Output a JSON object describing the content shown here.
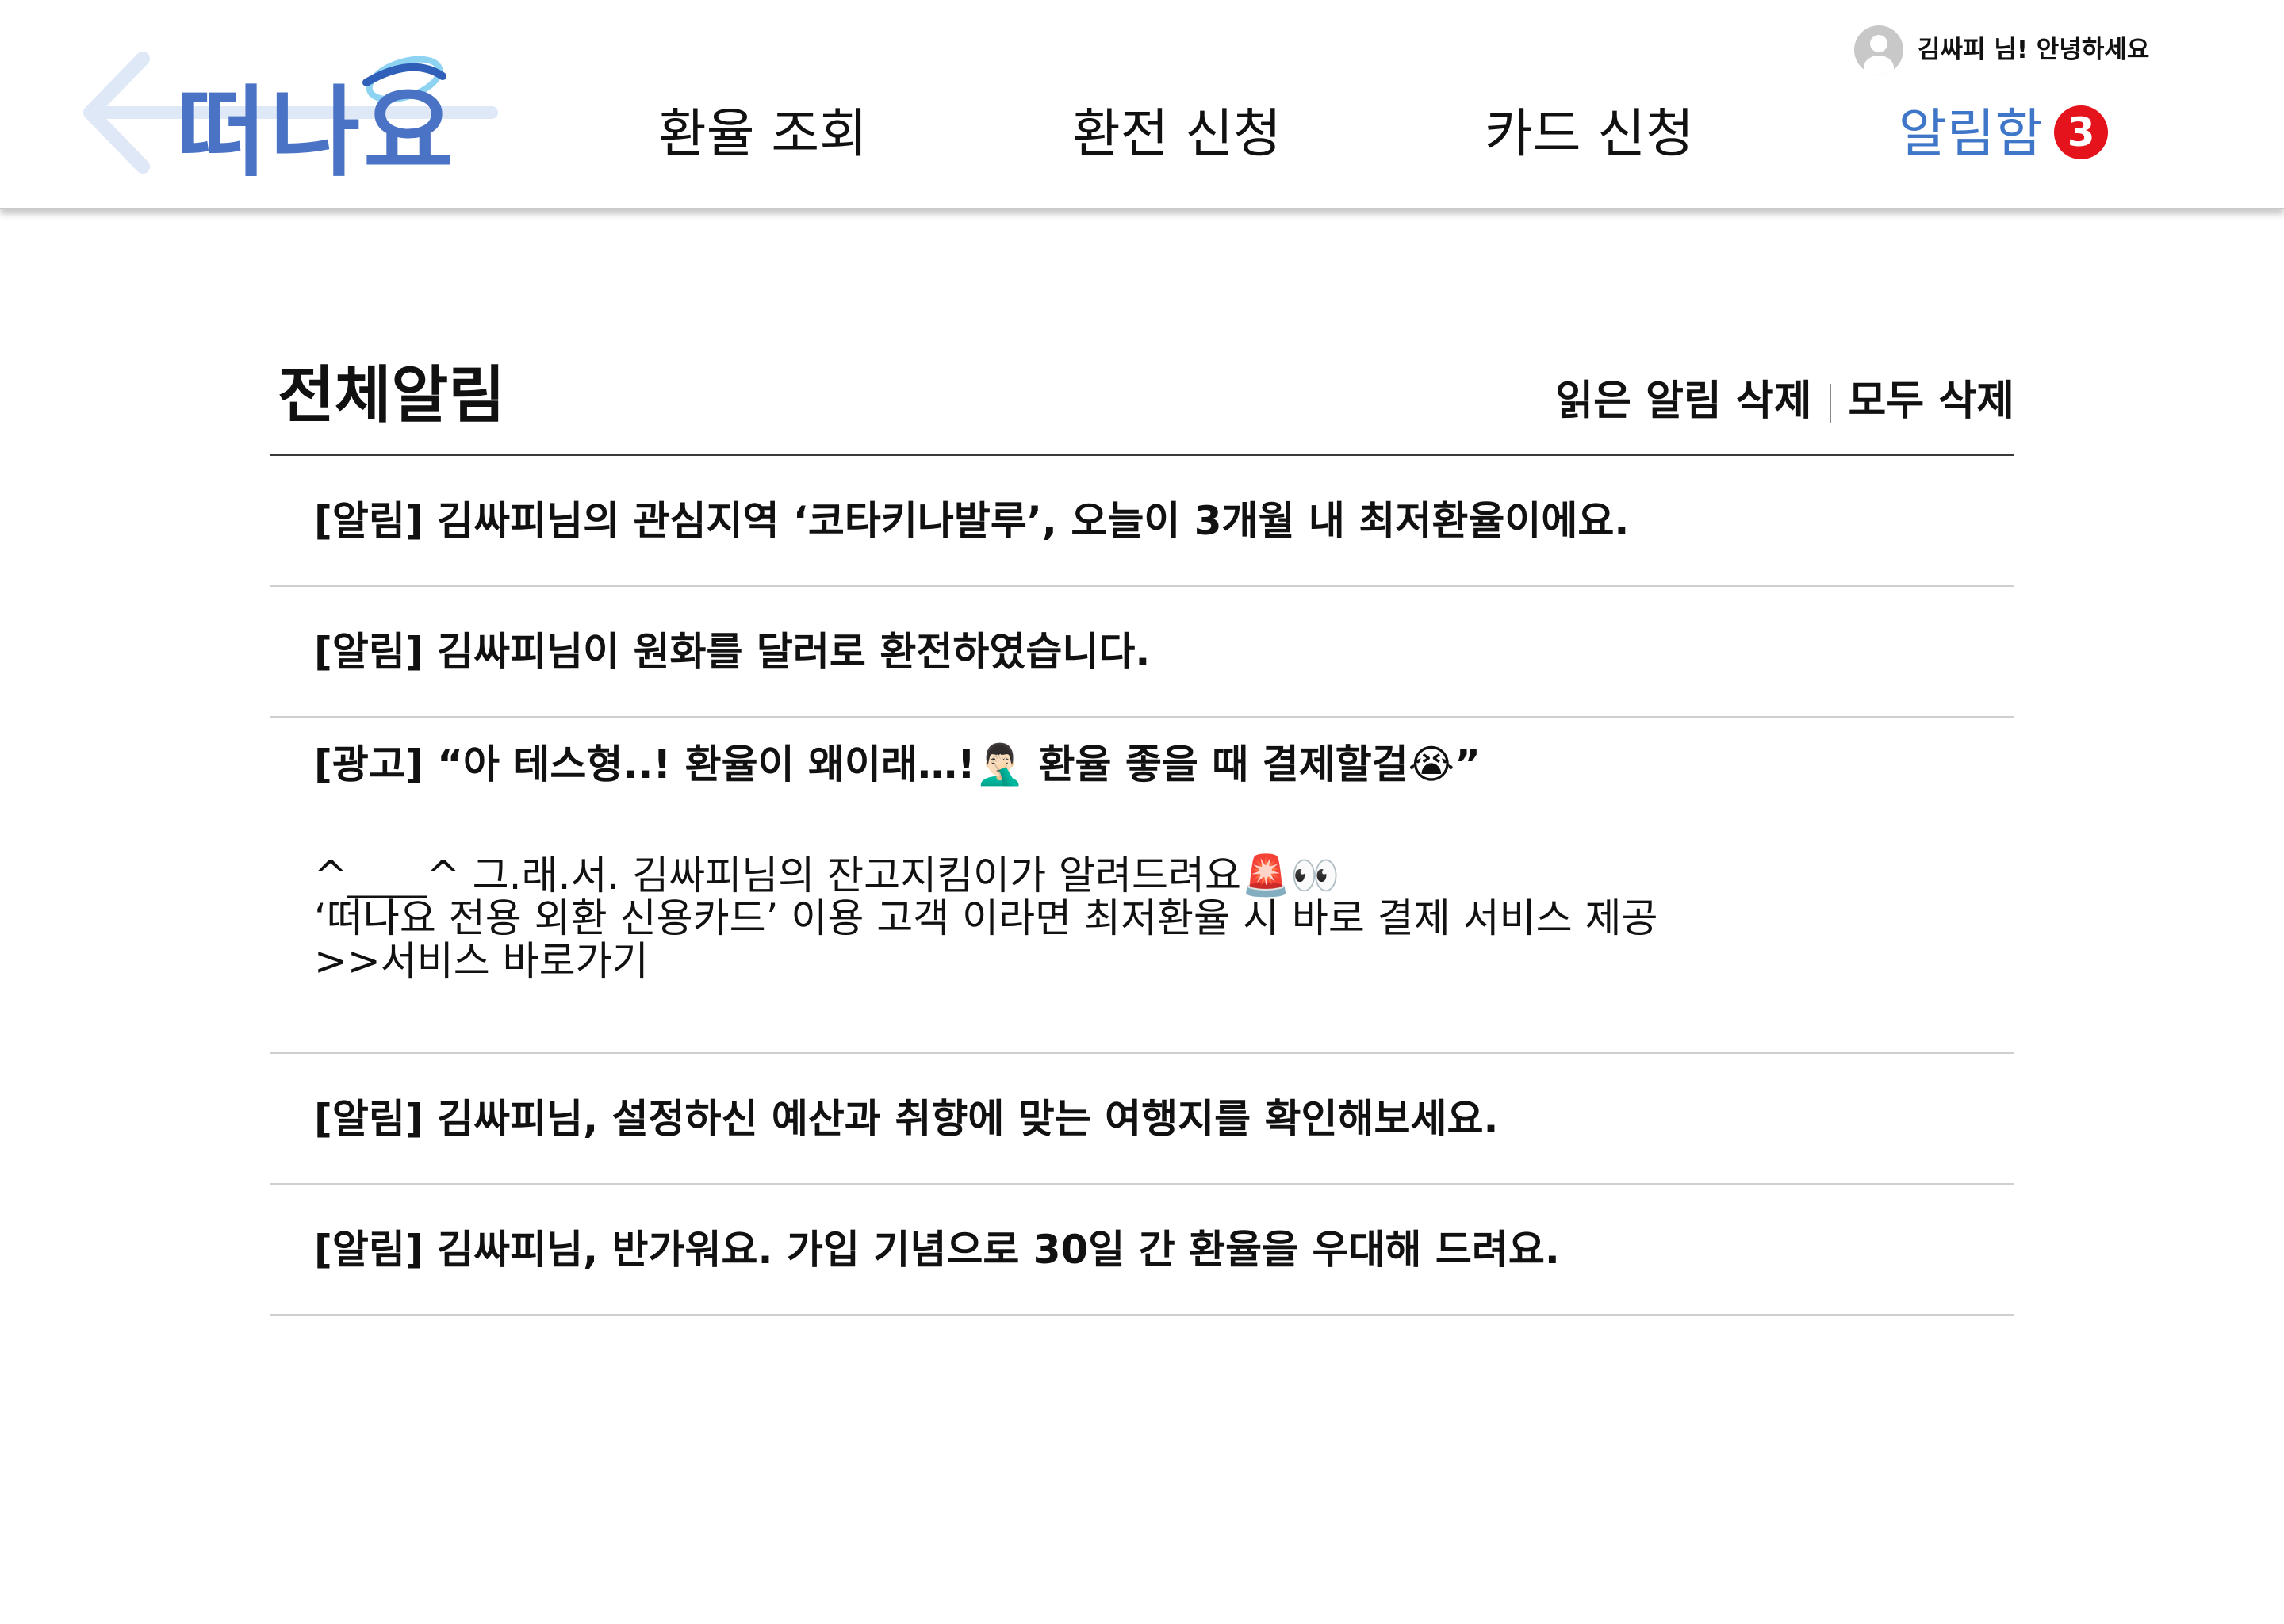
{
  "header": {
    "logo_text": "떠나요",
    "nav": [
      {
        "label": "환율 조회"
      },
      {
        "label": "환전 신청"
      },
      {
        "label": "카드 신청"
      },
      {
        "label": "알림함",
        "badge": "3"
      }
    ],
    "user_greeting": "김싸피 님! 안녕하세요"
  },
  "main": {
    "title": "전체알림",
    "actions": {
      "delete_read": "읽은 알림 삭제",
      "delete_all": "모두 삭제"
    },
    "notifications": [
      {
        "text": "[알림] 김싸피님의 관심지역 ‘코타키나발루’, 오늘이 3개월 내 최저환율이에요."
      },
      {
        "text": "[알림] 김싸피님이 원화를 달러로 환전하였습니다."
      },
      {
        "headline": "[광고] “아 테스형..! 환율이 왜이래…!🤦🏻‍♂️ 환율 좋을 때 결제할걸😭”",
        "line1": "^____^ 그.래.서. 김싸피님의 잔고지킴이가 알려드려요🚨👀",
        "line2": "‘떠나요 전용 외환 신용카드’ 이용 고객 이라면 최저환율 시 바로 결제 서비스 제공",
        "link": ">>서비스 바로가기"
      },
      {
        "text": "[알림] 김싸피님, 설정하신 예산과 취향에 맞는 여행지를 확인해보세요."
      },
      {
        "text": "[알림] 김싸피님, 반가워요. 가입 기념으로 30일 간 환율을 우대해 드려요."
      }
    ]
  }
}
